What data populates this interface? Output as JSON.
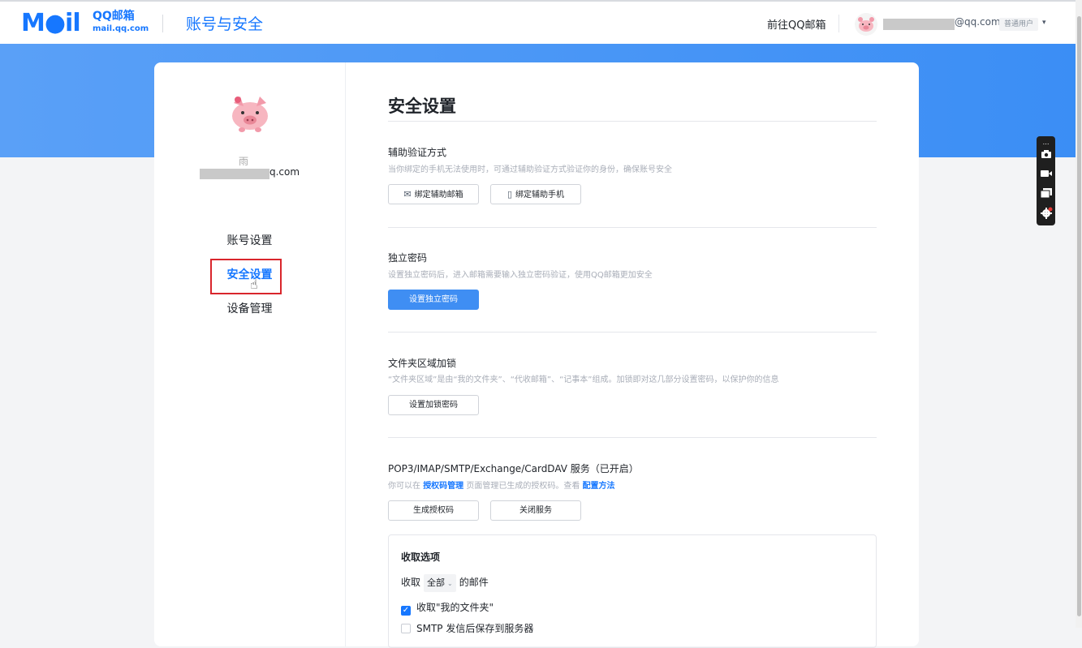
{
  "header": {
    "logo_mail": "M",
    "logo_o": "●",
    "logo_il": "il",
    "logo_qq": "QQ邮箱",
    "logo_url": "mail.qq.com",
    "app_title": "账号与安全",
    "goto_link": "前往QQ邮箱",
    "email_suffix": "@qq.com",
    "user_badge": "普通用户",
    "caret": "▾"
  },
  "profile": {
    "nickname": "雨",
    "email_suffix": "q.com"
  },
  "nav": {
    "items": [
      {
        "label": "账号设置"
      },
      {
        "label": "安全设置"
      },
      {
        "label": "设备管理"
      }
    ],
    "active_index": 1
  },
  "main": {
    "title": "安全设置",
    "sections": [
      {
        "title": "辅助验证方式",
        "desc": "当你绑定的手机无法使用时，可通过辅助验证方式验证你的身份，确保账号安全",
        "buttons": [
          {
            "label": "绑定辅助邮箱",
            "icon": "mail-icon"
          },
          {
            "label": "绑定辅助手机",
            "icon": "phone-icon"
          }
        ]
      },
      {
        "title": "独立密码",
        "desc": "设置独立密码后，进入邮箱需要输入独立密码验证，使用QQ邮箱更加安全",
        "buttons": [
          {
            "label": "设置独立密码"
          }
        ]
      },
      {
        "title": "文件夹区域加锁",
        "desc": "“文件夹区域”是由“我的文件夹”、“代收邮箱”、“记事本”组成。加锁即对这几部分设置密码，以保护你的信息",
        "buttons": [
          {
            "label": "设置加锁密码"
          }
        ]
      },
      {
        "title": "POP3/IMAP/SMTP/Exchange/CardDAV 服务（已开启）",
        "desc_prefix": "你可以在",
        "desc_link1": "授权码管理",
        "desc_mid": "页面管理已生成的授权码。查看",
        "desc_link2": "配置方法",
        "buttons": [
          {
            "label": "生成授权码"
          },
          {
            "label": "关闭服务"
          }
        ]
      }
    ],
    "options": {
      "title": "收取选项",
      "receive_prefix": "收取",
      "receive_value": "全部",
      "receive_suffix": "的邮件",
      "checks": [
        {
          "label": "收取\"我的文件夹\"",
          "checked": true
        },
        {
          "label": "SMTP 发信后保存到服务器",
          "checked": false
        }
      ]
    }
  },
  "colors": {
    "accent": "#1677ff",
    "banner": "#3b8ef5",
    "primary_button": "#3f8ef3",
    "highlight_box": "#d9262c"
  }
}
